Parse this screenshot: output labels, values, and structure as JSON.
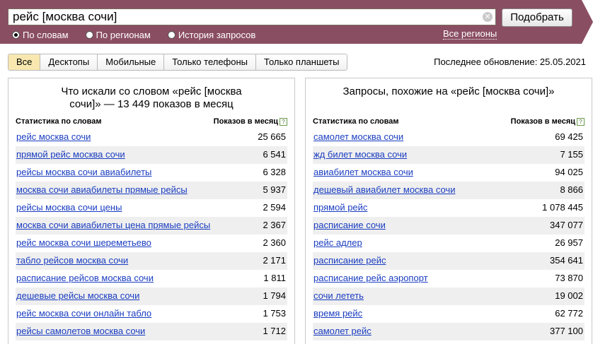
{
  "search": {
    "query": "рейс [москва сочи]",
    "button": "Подобрать",
    "modes": [
      "По словам",
      "По регионам",
      "История запросов"
    ],
    "all_regions": "Все регионы"
  },
  "tabs": [
    "Все",
    "Десктопы",
    "Мобильные",
    "Только телефоны",
    "Только планшеты"
  ],
  "updated": "Последнее обновление: 25.05.2021",
  "left_panel": {
    "title_line1": "Что искали со словом «рейс [москва",
    "title_line2": "сочи]» — 13 449 показов в месяц",
    "col_phrase": "Статистика по словам",
    "col_count": "Показов в месяц",
    "help": "?",
    "rows": [
      {
        "phrase": "рейс москва сочи",
        "count": "25 665"
      },
      {
        "phrase": "прямой рейс москва сочи",
        "count": "6 541"
      },
      {
        "phrase": "рейсы москва сочи авиабилеты",
        "count": "6 328"
      },
      {
        "phrase": "москва сочи авиабилеты прямые рейсы",
        "count": "5 937"
      },
      {
        "phrase": "рейсы москва сочи цены",
        "count": "2 594"
      },
      {
        "phrase": "москва сочи авиабилеты цена прямые рейсы",
        "count": "2 367"
      },
      {
        "phrase": "рейс москва сочи шереметьево",
        "count": "2 360"
      },
      {
        "phrase": "табло рейсов москва сочи",
        "count": "2 171"
      },
      {
        "phrase": "расписание рейсов москва сочи",
        "count": "1 811"
      },
      {
        "phrase": "дешевые рейсы москва сочи",
        "count": "1 794"
      },
      {
        "phrase": "рейс москва сочи онлайн табло",
        "count": "1 753"
      },
      {
        "phrase": "рейсы самолетов москва сочи",
        "count": "1 712"
      }
    ]
  },
  "right_panel": {
    "title": "Запросы, похожие на «рейс [москва сочи]»",
    "col_phrase": "Статистика по словам",
    "col_count": "Показов в месяц",
    "help": "?",
    "rows": [
      {
        "phrase": "самолет москва сочи",
        "count": "69 425"
      },
      {
        "phrase": "жд билет москва сочи",
        "count": "7 155"
      },
      {
        "phrase": "авиабилет москва сочи",
        "count": "94 025"
      },
      {
        "phrase": "дешевый авиабилет москва сочи",
        "count": "8 866"
      },
      {
        "phrase": "прямой рейс",
        "count": "1 078 445"
      },
      {
        "phrase": "расписание сочи",
        "count": "347 077"
      },
      {
        "phrase": "рейс адлер",
        "count": "26 957"
      },
      {
        "phrase": "расписание рейс",
        "count": "354 641"
      },
      {
        "phrase": "расписание рейс аэропорт",
        "count": "73 870"
      },
      {
        "phrase": "сочи лететь",
        "count": "19 002"
      },
      {
        "phrase": "время рейс",
        "count": "62 772"
      },
      {
        "phrase": "самолет рейс",
        "count": "377 100"
      }
    ]
  },
  "colors": {
    "header_bg": "#8a4e63",
    "tab_active": "#f8e8b0",
    "link": "#1a3dc1",
    "row_alt": "#efefef"
  }
}
